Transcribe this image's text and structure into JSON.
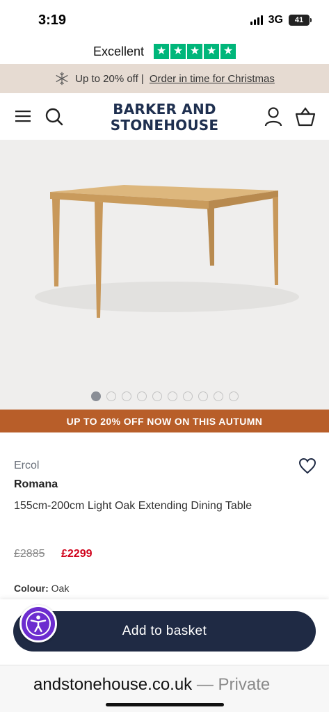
{
  "status_bar": {
    "time": "3:19",
    "network": "3G",
    "battery": "41"
  },
  "trustpilot": {
    "label": "Excellent",
    "rating_stars": 5,
    "color": "#00b67a"
  },
  "promo": {
    "text": "Up to 20% off |",
    "link": "Order in time for Christmas",
    "icon": "snowflake-icon"
  },
  "header": {
    "logo_line1": "BARKER AND",
    "logo_line2": "STONEHOUSE",
    "icons": [
      "menu-icon",
      "search-icon",
      "account-icon",
      "basket-icon"
    ]
  },
  "gallery": {
    "image_count": 10,
    "active_index": 0
  },
  "offer_banner": {
    "text": "UP TO 20% OFF NOW ON THIS AUTUMN",
    "color": "#b85e29"
  },
  "product": {
    "brand": "Ercol",
    "name": "Romana",
    "description": "155cm-200cm Light Oak Extending Dining Table",
    "old_price": "£2885",
    "new_price": "£2299",
    "colour_label": "Colour:",
    "colour_value": "Oak"
  },
  "actions": {
    "add_to_basket": "Add to basket",
    "accessibility_icon": "accessibility-icon"
  },
  "browser": {
    "url": "andstonehouse.co.uk",
    "mode": "— Private"
  },
  "colors": {
    "navy": "#1f2a44",
    "sale_red": "#d0021b",
    "promo_bg": "#e6dbd2",
    "accessibility_purple": "#6c2ccf"
  }
}
